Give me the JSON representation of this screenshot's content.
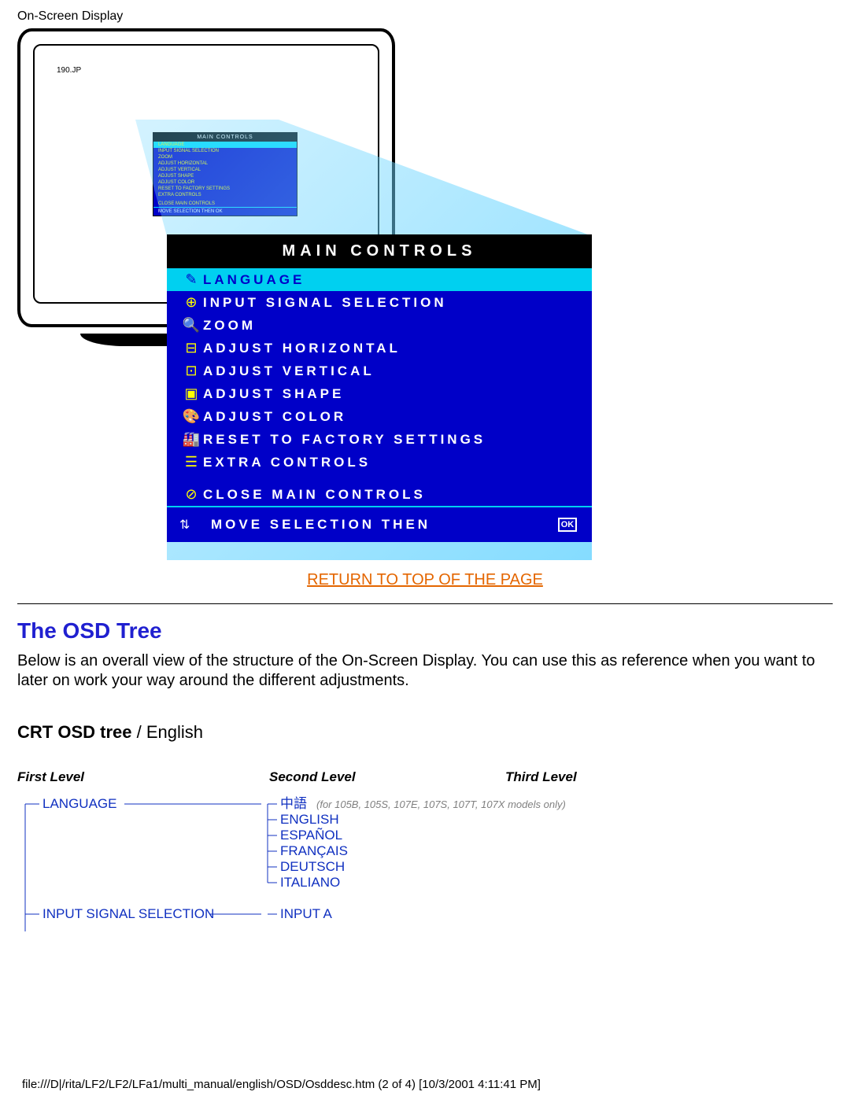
{
  "header": "On-Screen Display",
  "monitor_model": "190.JP",
  "osd": {
    "title": "MAIN CONTROLS",
    "items": [
      {
        "icon": "lang-icon",
        "label": "LANGUAGE",
        "hl": true
      },
      {
        "icon": "input-icon",
        "label": "INPUT SIGNAL SELECTION"
      },
      {
        "icon": "zoom-icon",
        "label": "ZOOM"
      },
      {
        "icon": "horiz-icon",
        "label": "ADJUST HORIZONTAL"
      },
      {
        "icon": "vert-icon",
        "label": "ADJUST VERTICAL"
      },
      {
        "icon": "shape-icon",
        "label": "ADJUST SHAPE"
      },
      {
        "icon": "color-icon",
        "label": "ADJUST COLOR"
      },
      {
        "icon": "reset-icon",
        "label": "RESET TO FACTORY SETTINGS"
      },
      {
        "icon": "extra-icon",
        "label": "EXTRA CONTROLS"
      }
    ],
    "close": {
      "icon": "close-icon",
      "label": "CLOSE MAIN CONTROLS"
    },
    "footer_text": "MOVE SELECTION THEN",
    "footer_ok": "OK"
  },
  "mini": {
    "title": "MAIN CONTROLS",
    "rows": [
      "LANGUAGE",
      "INPUT SIGNAL SELECTION",
      "ZOOM",
      "ADJUST HORIZONTAL",
      "ADJUST VERTICAL",
      "ADJUST SHAPE",
      "ADJUST COLOR",
      "RESET TO FACTORY SETTINGS",
      "EXTRA CONTROLS"
    ],
    "close": "CLOSE MAIN CONTROLS",
    "foot": "MOVE SELECTION THEN  OK"
  },
  "return_link": "RETURN TO TOP OF THE PAGE",
  "section": {
    "heading": "The OSD Tree",
    "paragraph": "Below is an overall view of the structure of the On-Screen Display. You can use this as reference when you want to later on work your way around the different adjustments."
  },
  "tree": {
    "title_bold": "CRT OSD tree ",
    "title_sep": "/ ",
    "title_lang": "English",
    "levels": [
      "First Level",
      "Second Level",
      "Third Level"
    ],
    "l1": [
      "LANGUAGE",
      "INPUT SIGNAL SELECTION"
    ],
    "l2_lang": [
      "中語",
      "ENGLISH",
      "ESPAÑOL",
      "FRANÇAIS",
      "DEUTSCH",
      "ITALIANO"
    ],
    "l2_lang_note": "(for 105B, 105S, 107E, 107S, 107T, 107X models only)",
    "l2_input": [
      "INPUT A"
    ]
  },
  "footer_path": "file:///D|/rita/LF2/LF2/LFa1/multi_manual/english/OSD/Osddesc.htm (2 of 4) [10/3/2001 4:11:41 PM]"
}
